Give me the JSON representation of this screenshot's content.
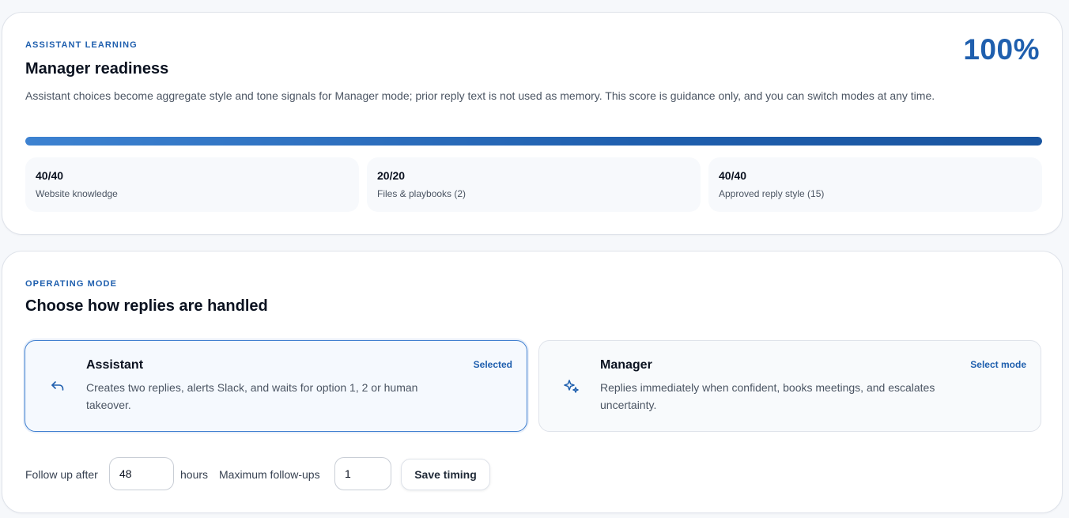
{
  "readiness": {
    "eyebrow": "ASSISTANT LEARNING",
    "title": "Manager readiness",
    "description": "Assistant choices become aggregate style and tone signals for Manager mode; prior reply text is not used as memory. This score is guidance only, and you can switch modes at any time.",
    "score": "100%",
    "progress_percent": 100,
    "stats": [
      {
        "value": "40/40",
        "label": "Website knowledge"
      },
      {
        "value": "20/20",
        "label": "Files & playbooks (2)"
      },
      {
        "value": "40/40",
        "label": "Approved reply style (15)"
      }
    ]
  },
  "mode": {
    "eyebrow": "OPERATING MODE",
    "title": "Choose how replies are handled",
    "options": [
      {
        "name": "Assistant",
        "description": "Creates two replies, alerts Slack, and waits for option 1, 2 or human takeover.",
        "status": "Selected",
        "icon": "reply-arrow-icon",
        "selected": true
      },
      {
        "name": "Manager",
        "description": "Replies immediately when confident, books meetings, and escalates uncertainty.",
        "status": "Select mode",
        "icon": "sparkles-icon",
        "selected": false
      }
    ]
  },
  "timing": {
    "followup_label": "Follow up after",
    "followup_value": "48",
    "hours_label": "hours",
    "max_followups_label": "Maximum follow-ups",
    "max_followups_value": "1",
    "save_label": "Save timing"
  },
  "colors": {
    "accent": "#1f5fae",
    "selected_border": "#3f7fd0"
  }
}
